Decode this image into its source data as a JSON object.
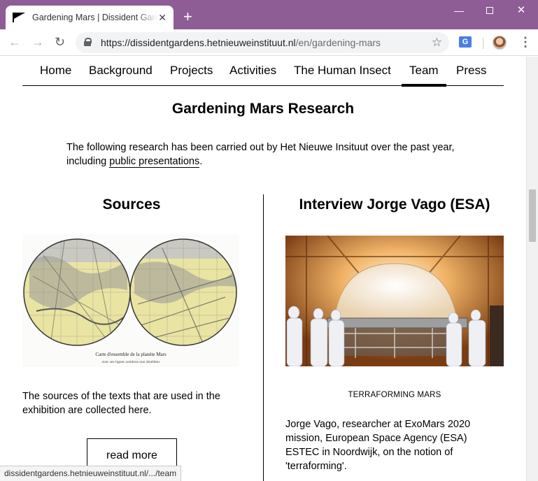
{
  "browser": {
    "tab_title": "Gardening Mars | Dissident Gardens",
    "tab_close": "✕",
    "new_tab": "+",
    "url_host": "https://dissidentgardens.hetnieuweinstituut.nl",
    "url_path": "/en/gardening-mars",
    "status_url": "dissidentgardens.hetnieuweinstituut.nl/.../team"
  },
  "nav": {
    "items": [
      "Home",
      "Background",
      "Projects",
      "Activities",
      "The Human Insect",
      "Team",
      "Press"
    ],
    "active": "Team"
  },
  "page": {
    "title": "Gardening Mars Research",
    "intro_before": "The following research has been carried out by Het Nieuwe Insituut over the past year, including ",
    "intro_link": "public presentations",
    "intro_after": "."
  },
  "sources": {
    "title": "Sources",
    "map_caption_line1": "Carte d'ensemble de la planète Mars",
    "map_caption_line2": "avec ses lignes sombres non doublées",
    "text": "The sources of the texts that are used in the exhibition are collected here.",
    "button": "read more"
  },
  "interview": {
    "title": "Interview Jorge Vago (ESA)",
    "caption": "TERRAFORMING MARS",
    "text": "Jorge Vago, researcher at ExoMars 2020 mission, European Space Agency (ESA) ESTEC in Noordwijk, on the notion of 'terraforming'."
  },
  "colors": {
    "titlebar": "#8e5d96",
    "map_land": "#e9e4a2",
    "photo_warm": "#d9822e"
  }
}
